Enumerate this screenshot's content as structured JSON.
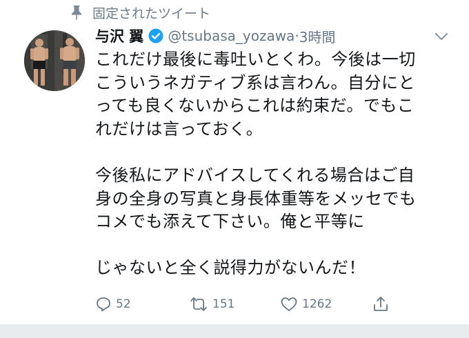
{
  "pinned_label": "固定されたツイート",
  "author": {
    "name": "与沢 翼",
    "handle": "@tsubasa_yozawa",
    "time": "3時間"
  },
  "tweet_lines": [
    "これだけ最後に毒吐いとくわ。今後は一切",
    "こういうネガティブ系は言わん。自分にと",
    "っても良くないからこれは約束だ。でもこ",
    "れだけは言っておく。",
    "",
    "今後私にアドバイスしてくれる場合はご自",
    "身の全身の写真と身長体重等をメッセでも",
    "コメでも添えて下さい。俺と平等に",
    "",
    "じゃないと全く説得力がないんだ！"
  ],
  "actions": {
    "replies": "52",
    "retweets": "151",
    "likes": "1262"
  },
  "colors": {
    "verified_blue": "#1da1f2",
    "muted_text": "#657786",
    "text": "#14171a"
  },
  "icons": [
    "pin-icon",
    "verified-badge-icon",
    "chevron-down-icon",
    "reply-icon",
    "retweet-icon",
    "like-icon",
    "share-icon"
  ]
}
